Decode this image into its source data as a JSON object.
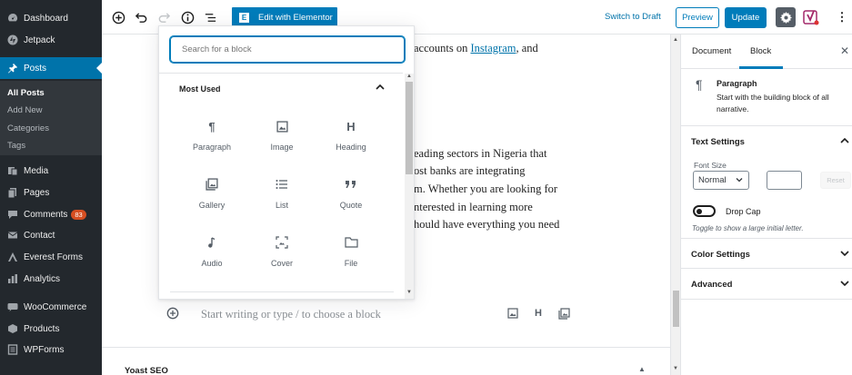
{
  "admin_menu": {
    "items": [
      {
        "label": "Dashboard",
        "icon": "dashboard-icon"
      },
      {
        "label": "Jetpack",
        "icon": "jetpack-icon"
      },
      {
        "label": "Posts",
        "icon": "pin-icon"
      },
      {
        "label": "Media",
        "icon": "media-icon"
      },
      {
        "label": "Pages",
        "icon": "pages-icon"
      },
      {
        "label": "Comments",
        "icon": "comments-icon",
        "badge": "83"
      },
      {
        "label": "Contact",
        "icon": "contact-icon"
      },
      {
        "label": "Everest Forms",
        "icon": "forms-icon"
      },
      {
        "label": "Analytics",
        "icon": "analytics-icon"
      },
      {
        "label": "WooCommerce",
        "icon": "woocommerce-icon"
      },
      {
        "label": "Products",
        "icon": "products-icon"
      },
      {
        "label": "WPForms",
        "icon": "wpforms-icon"
      }
    ],
    "posts_submenu": [
      "All Posts",
      "Add New",
      "Categories",
      "Tags"
    ]
  },
  "toolbar": {
    "elementor_label": "Edit with Elementor",
    "switch_to_draft": "Switch to Draft",
    "preview": "Preview",
    "update": "Update"
  },
  "editor": {
    "line1_text": "accounts on ",
    "line1_link": "Instagram",
    "line1_end": ", and",
    "paragraph_lines": [
      "eading sectors in Nigeria that",
      "ost banks are integrating",
      "m. Whether you are looking for",
      "nterested in learning more",
      "hould have everything you need"
    ],
    "appender_placeholder": "Start writing or type / to choose a block",
    "meta_box_title": "Yoast SEO"
  },
  "inserter": {
    "search_placeholder": "Search for a block",
    "panel_title": "Most Used",
    "blocks": [
      {
        "label": "Paragraph",
        "icon": "paragraph-icon"
      },
      {
        "label": "Image",
        "icon": "image-icon"
      },
      {
        "label": "Heading",
        "icon": "heading-icon"
      },
      {
        "label": "Gallery",
        "icon": "gallery-icon"
      },
      {
        "label": "List",
        "icon": "list-icon"
      },
      {
        "label": "Quote",
        "icon": "quote-icon"
      },
      {
        "label": "Audio",
        "icon": "audio-icon"
      },
      {
        "label": "Cover",
        "icon": "cover-icon"
      },
      {
        "label": "File",
        "icon": "file-icon"
      }
    ]
  },
  "settings_sidebar": {
    "tab_document": "Document",
    "tab_block": "Block",
    "block_title": "Paragraph",
    "block_description": "Start with the building block of all narrative.",
    "text_settings": "Text Settings",
    "font_size_label": "Font Size",
    "font_size_value": "Normal",
    "reset_label": "Reset",
    "drop_cap_label": "Drop Cap",
    "drop_cap_help": "Toggle to show a large initial letter.",
    "color_settings": "Color Settings",
    "advanced": "Advanced"
  },
  "colors": {
    "accent": "#007cba",
    "admin_bg": "#23282d",
    "admin_active": "#0073aa"
  }
}
